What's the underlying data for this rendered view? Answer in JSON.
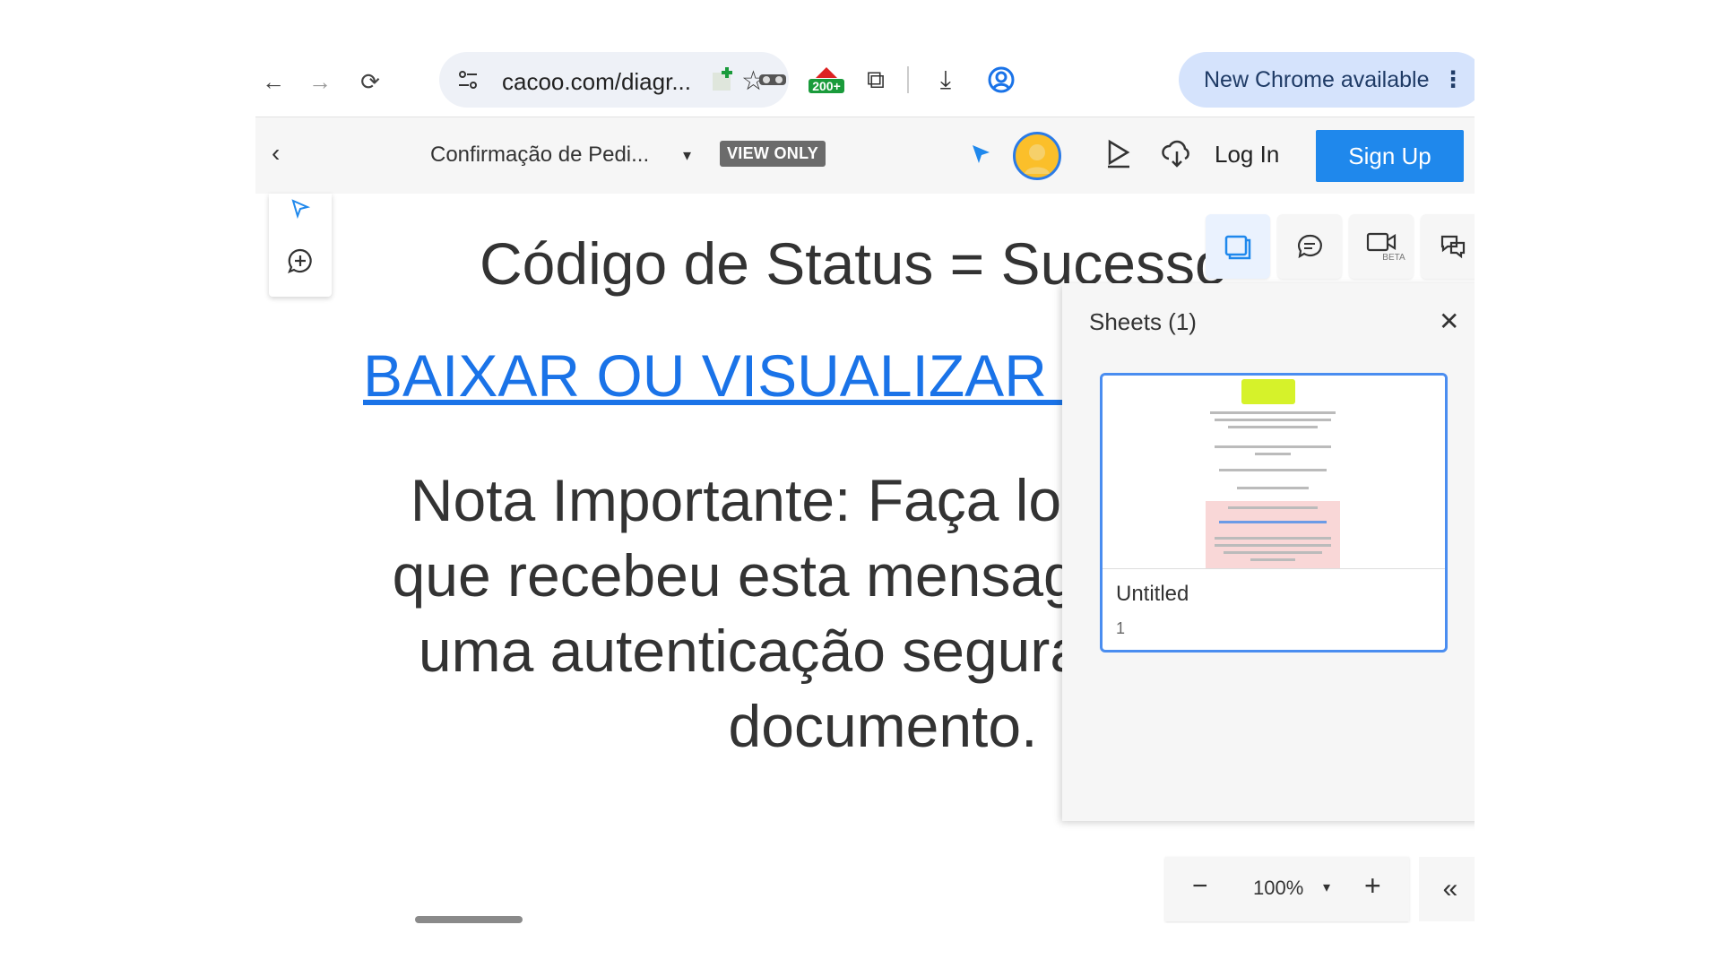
{
  "browser": {
    "url": "cacoo.com/diagr...",
    "new_chrome_label": "New Chrome available",
    "extension_badge": "200+"
  },
  "app": {
    "doc_title": "Confirmação de Pedi...",
    "view_only_label": "VIEW ONLY",
    "login_label": "Log In",
    "signup_label": "Sign Up"
  },
  "canvas": {
    "status_text": "Código de Status = Sucesso",
    "download_link": "BAIXAR OU VISUALIZAR DO",
    "note_lines": [
      "Nota Importante: Faça login",
      "que recebeu esta mensagem",
      "uma autenticação segura e",
      "documento."
    ]
  },
  "sheets_panel": {
    "title": "Sheets (1)",
    "sheet_name": "Untitled",
    "sheet_number": "1"
  },
  "panel_buttons": {
    "video_badge": "BETA"
  },
  "zoom": {
    "value": "100%"
  },
  "colors": {
    "accent": "#1f88ec",
    "link": "#1a73e8",
    "chrome_banner": "#d5e3fc"
  }
}
